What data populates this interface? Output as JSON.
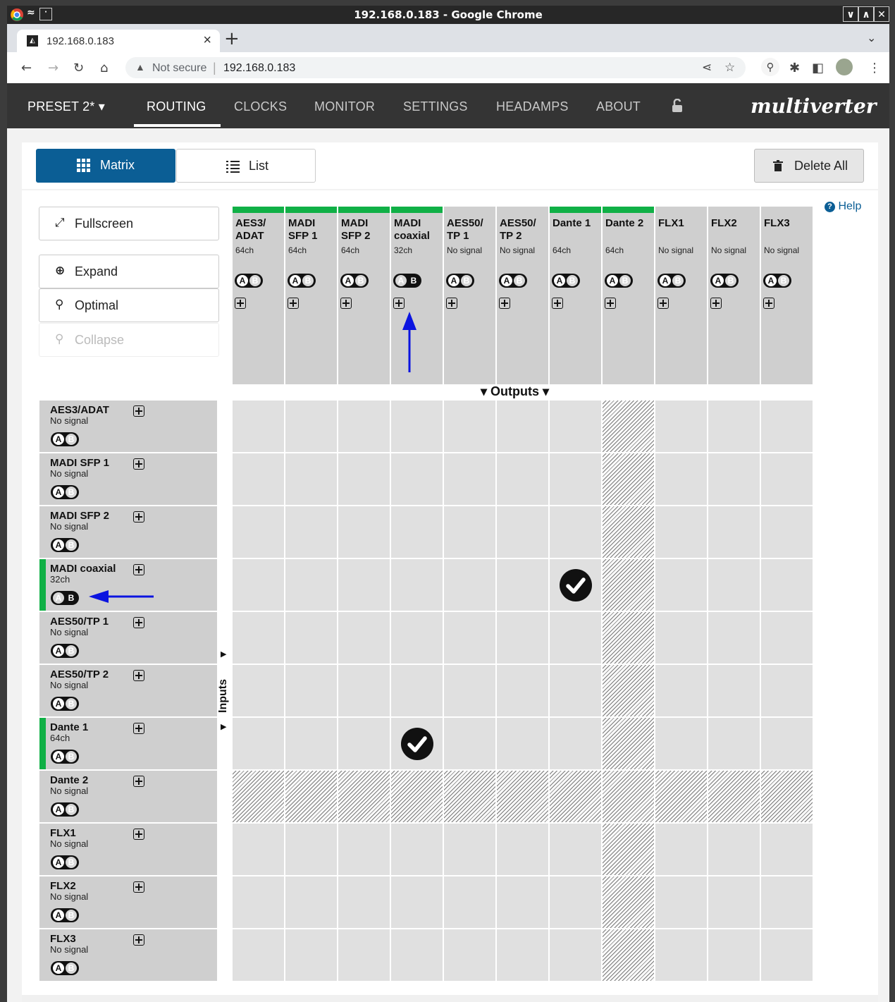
{
  "window": {
    "title": "192.168.0.183 - Google Chrome"
  },
  "browser": {
    "tab_title": "192.168.0.183",
    "new_tab": "+",
    "not_secure": "Not secure",
    "url": "192.168.0.183"
  },
  "app": {
    "preset": "PRESET 2*",
    "nav": [
      "ROUTING",
      "CLOCKS",
      "MONITOR",
      "SETTINGS",
      "HEADAMPS",
      "ABOUT"
    ],
    "active_nav": "ROUTING",
    "brand": "multiverter",
    "colors": {
      "accent": "#0b5e95",
      "signal_green": "#10b046",
      "nav_bg": "#343434"
    }
  },
  "toolbar": {
    "matrix": "Matrix",
    "list": "List",
    "delete_all": "Delete All"
  },
  "help": "Help",
  "side_buttons": {
    "fullscreen": "Fullscreen",
    "expand": "Expand",
    "optimal": "Optimal",
    "collapse": "Collapse"
  },
  "outputs_label": "Outputs",
  "inputs_label": "Inputs",
  "columns": [
    {
      "name": "AES3/\nADAT",
      "status": "64ch",
      "active": true,
      "ab": "A"
    },
    {
      "name": "MADI\nSFP 1",
      "status": "64ch",
      "active": true,
      "ab": "A"
    },
    {
      "name": "MADI\nSFP 2",
      "status": "64ch",
      "active": true,
      "ab": "A"
    },
    {
      "name": "MADI\ncoaxial",
      "status": "32ch",
      "active": true,
      "ab": "B"
    },
    {
      "name": "AES50/\nTP 1",
      "status": "No signal",
      "active": false,
      "ab": "A"
    },
    {
      "name": "AES50/\nTP 2",
      "status": "No signal",
      "active": false,
      "ab": "A"
    },
    {
      "name": "Dante 1",
      "status": "64ch",
      "active": true,
      "ab": "A"
    },
    {
      "name": "Dante 2",
      "status": "64ch",
      "active": true,
      "ab": "A"
    },
    {
      "name": "FLX1",
      "status": "No signal",
      "active": false,
      "ab": "A"
    },
    {
      "name": "FLX2",
      "status": "No signal",
      "active": false,
      "ab": "A"
    },
    {
      "name": "FLX3",
      "status": "No signal",
      "active": false,
      "ab": "A"
    }
  ],
  "rows": [
    {
      "name": "AES3/ADAT",
      "status": "No signal",
      "active": false,
      "ab": "A"
    },
    {
      "name": "MADI SFP 1",
      "status": "No signal",
      "active": false,
      "ab": "A"
    },
    {
      "name": "MADI SFP 2",
      "status": "No signal",
      "active": false,
      "ab": "A"
    },
    {
      "name": "MADI coaxial",
      "status": "32ch",
      "active": true,
      "ab": "B"
    },
    {
      "name": "AES50/TP 1",
      "status": "No signal",
      "active": false,
      "ab": "A"
    },
    {
      "name": "AES50/TP 2",
      "status": "No signal",
      "active": false,
      "ab": "A"
    },
    {
      "name": "Dante 1",
      "status": "64ch",
      "active": true,
      "ab": "A"
    },
    {
      "name": "Dante 2",
      "status": "No signal",
      "active": false,
      "ab": "A"
    },
    {
      "name": "FLX1",
      "status": "No signal",
      "active": false,
      "ab": "A"
    },
    {
      "name": "FLX2",
      "status": "No signal",
      "active": false,
      "ab": "A"
    },
    {
      "name": "FLX3",
      "status": "No signal",
      "active": false,
      "ab": "A"
    }
  ],
  "hatched_column": 7,
  "hatched_row": 7,
  "routes": [
    {
      "row": 3,
      "col": 6
    },
    {
      "row": 6,
      "col": 3
    }
  ]
}
